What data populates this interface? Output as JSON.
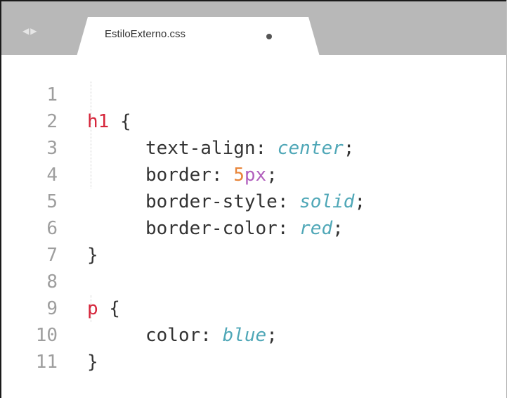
{
  "tabbar": {
    "nav_left": "◀",
    "nav_right": "▶",
    "active_tab": {
      "title": "EstiloExterno.css",
      "modified_indicator": "●"
    }
  },
  "editor": {
    "lines": [
      {
        "number": "1",
        "selector": "h1",
        "open": " {"
      },
      {
        "number": "2",
        "property": "text-align",
        "colon": ": ",
        "value": "center",
        "semicolon": ";"
      },
      {
        "number": "3",
        "property": "border",
        "colon": ": ",
        "num": "5",
        "unit": "px",
        "semicolon": ";"
      },
      {
        "number": "4",
        "property": "border-style",
        "colon": ": ",
        "value": "solid",
        "semicolon": ";"
      },
      {
        "number": "5",
        "property": "border-color",
        "colon": ": ",
        "value": "red",
        "semicolon": ";"
      },
      {
        "number": "6",
        "close": "}"
      },
      {
        "number": "7"
      },
      {
        "number": "8",
        "selector": "p",
        "open": " {"
      },
      {
        "number": "9",
        "property": "color",
        "colon": ": ",
        "value": "blue",
        "semicolon": ";"
      },
      {
        "number": "10",
        "close": "}"
      },
      {
        "number": "11"
      }
    ]
  },
  "colors": {
    "selector": "#d6263b",
    "value_keyword": "#4fa7b7",
    "number": "#e8853a",
    "unit": "#b15ebd",
    "gutter": "#9e9e9e",
    "tabbar": "#b8b8b8"
  }
}
